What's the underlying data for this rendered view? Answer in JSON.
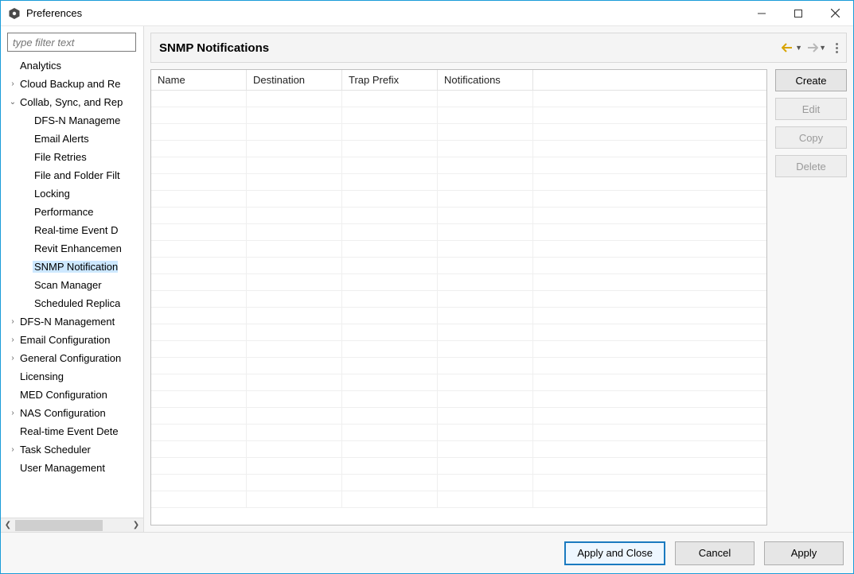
{
  "window": {
    "title": "Preferences"
  },
  "filter": {
    "placeholder": "type filter text"
  },
  "tree": {
    "items": [
      {
        "label": "Analytics",
        "indent": 1,
        "expander": "none"
      },
      {
        "label": "Cloud Backup and Re",
        "indent": 1,
        "expander": "closed"
      },
      {
        "label": "Collab, Sync, and Rep",
        "indent": 1,
        "expander": "open"
      },
      {
        "label": "DFS-N Manageme",
        "indent": 2,
        "expander": "none"
      },
      {
        "label": "Email Alerts",
        "indent": 2,
        "expander": "none"
      },
      {
        "label": "File Retries",
        "indent": 2,
        "expander": "none"
      },
      {
        "label": "File and Folder Filt",
        "indent": 2,
        "expander": "none"
      },
      {
        "label": "Locking",
        "indent": 2,
        "expander": "none"
      },
      {
        "label": "Performance",
        "indent": 2,
        "expander": "none"
      },
      {
        "label": "Real-time Event D",
        "indent": 2,
        "expander": "none"
      },
      {
        "label": "Revit Enhancemen",
        "indent": 2,
        "expander": "none"
      },
      {
        "label": "SNMP Notification",
        "indent": 2,
        "expander": "none",
        "selected": true
      },
      {
        "label": "Scan Manager",
        "indent": 2,
        "expander": "none"
      },
      {
        "label": "Scheduled Replica",
        "indent": 2,
        "expander": "none"
      },
      {
        "label": "DFS-N Management",
        "indent": 1,
        "expander": "closed"
      },
      {
        "label": "Email Configuration",
        "indent": 1,
        "expander": "closed"
      },
      {
        "label": "General Configuration",
        "indent": 1,
        "expander": "closed"
      },
      {
        "label": "Licensing",
        "indent": 1,
        "expander": "none"
      },
      {
        "label": "MED Configuration",
        "indent": 1,
        "expander": "none"
      },
      {
        "label": "NAS Configuration",
        "indent": 1,
        "expander": "closed"
      },
      {
        "label": "Real-time Event Dete",
        "indent": 1,
        "expander": "none"
      },
      {
        "label": "Task Scheduler",
        "indent": 1,
        "expander": "closed"
      },
      {
        "label": "User Management",
        "indent": 1,
        "expander": "none"
      }
    ]
  },
  "main": {
    "heading": "SNMP Notifications",
    "columns": [
      "Name",
      "Destination",
      "Trap Prefix",
      "Notifications"
    ],
    "empty_row_count": 25
  },
  "actions": {
    "create": "Create",
    "edit": "Edit",
    "copy": "Copy",
    "delete": "Delete"
  },
  "footer": {
    "apply_close": "Apply and Close",
    "cancel": "Cancel",
    "apply": "Apply"
  },
  "colors": {
    "window_border": "#1a9cd8",
    "selection": "#cde8ff",
    "button_bg": "#e6e6e6",
    "primary_border": "#1a7ac0"
  }
}
